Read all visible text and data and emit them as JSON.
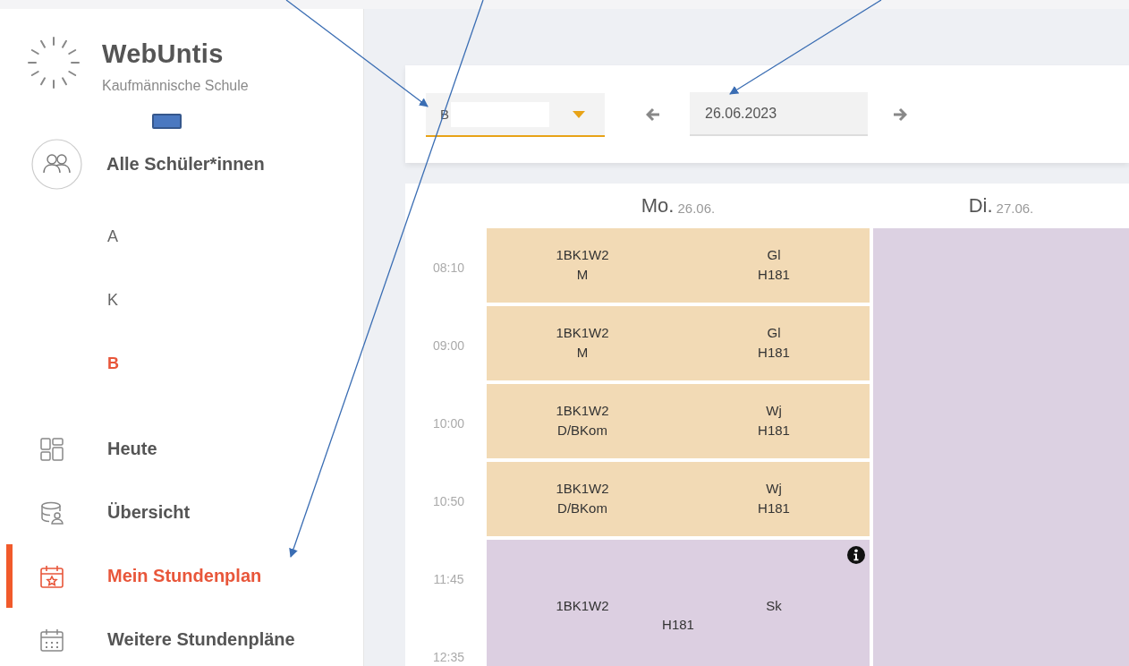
{
  "brand": {
    "title": "WebUntis",
    "subtitle": "Kaufmännische Schule"
  },
  "students": {
    "label": "Alle Schüler*innen",
    "items": [
      {
        "label": "A",
        "selected": false
      },
      {
        "label": "K",
        "selected": false
      },
      {
        "label": "B",
        "selected": true
      }
    ]
  },
  "nav": [
    {
      "label": "Heute",
      "selected": false
    },
    {
      "label": "Übersicht",
      "selected": false
    },
    {
      "label": "Mein Stundenplan",
      "selected": true
    },
    {
      "label": "Weitere Stundenpläne",
      "selected": false
    }
  ],
  "toolbar": {
    "class_select": {
      "value": "B"
    },
    "date_field": {
      "value": "26.06.2023"
    }
  },
  "timetable": {
    "days": [
      {
        "name": "Mo.",
        "date": "26.06.",
        "lessons": [
          {
            "kind": "single",
            "class": "1BK1W2",
            "subject": "M",
            "teacher": "Gl",
            "room": "H181",
            "color": "#f2dab5",
            "info": false
          },
          {
            "kind": "single",
            "class": "1BK1W2",
            "subject": "M",
            "teacher": "Gl",
            "room": "H181",
            "color": "#f2dab5",
            "info": false
          },
          {
            "kind": "single",
            "class": "1BK1W2",
            "subject": "D/BKom",
            "teacher": "Wj",
            "room": "H181",
            "color": "#f2dab5",
            "info": false
          },
          {
            "kind": "single",
            "class": "1BK1W2",
            "subject": "D/BKom",
            "teacher": "Wj",
            "room": "H181",
            "color": "#f2dab5",
            "info": false
          },
          {
            "kind": "double",
            "class": "1BK1W2",
            "teacher": "Sk",
            "room": "H181",
            "color": "#dccfe1",
            "info": true
          }
        ]
      },
      {
        "name": "Di.",
        "date": "27.06.",
        "lessons": [
          {
            "kind": "blank",
            "color": "#dcd1e2"
          }
        ]
      }
    ],
    "times": [
      "08:10",
      "09:00",
      "10:00",
      "10:50",
      "11:45",
      "12:35"
    ]
  },
  "annotations": [
    {
      "kind": "arrow"
    },
    {
      "kind": "arrow"
    },
    {
      "kind": "arrow"
    }
  ]
}
